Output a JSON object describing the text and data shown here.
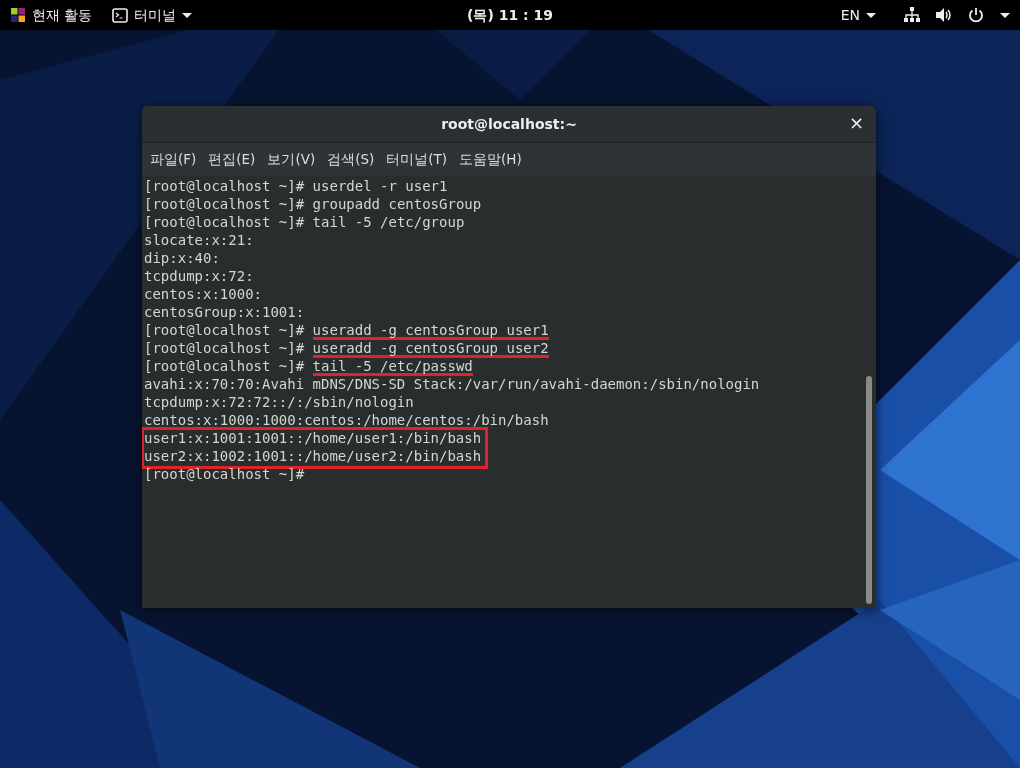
{
  "top_bar": {
    "activities": "현재 활동",
    "app_menu": "터미널",
    "clock": "(목) 11 : 19",
    "language": "EN"
  },
  "window": {
    "title": "root@localhost:~",
    "close": "×"
  },
  "menu": [
    "파일(F)",
    "편집(E)",
    "보기(V)",
    "검색(S)",
    "터미널(T)",
    "도움말(H)"
  ],
  "terminal": {
    "lines": [
      {
        "kind": "command",
        "prompt": "[root@localhost ~]#",
        "command": "userdel -r user1",
        "underlined": false,
        "boxed": false
      },
      {
        "kind": "command",
        "prompt": "[root@localhost ~]#",
        "command": "groupadd centosGroup",
        "underlined": false,
        "boxed": false
      },
      {
        "kind": "command",
        "prompt": "[root@localhost ~]#",
        "command": "tail -5 /etc/group",
        "underlined": false,
        "boxed": false
      },
      {
        "kind": "output",
        "text": "slocate:x:21:",
        "underlined": false,
        "boxed": false
      },
      {
        "kind": "output",
        "text": "dip:x:40:",
        "underlined": false,
        "boxed": false
      },
      {
        "kind": "output",
        "text": "tcpdump:x:72:",
        "underlined": false,
        "boxed": false
      },
      {
        "kind": "output",
        "text": "centos:x:1000:",
        "underlined": false,
        "boxed": false
      },
      {
        "kind": "output",
        "text": "centosGroup:x:1001:",
        "underlined": false,
        "boxed": false
      },
      {
        "kind": "command",
        "prompt": "[root@localhost ~]#",
        "command": "useradd -g centosGroup user1",
        "underlined": true,
        "boxed": false
      },
      {
        "kind": "command",
        "prompt": "[root@localhost ~]#",
        "command": "useradd -g centosGroup user2",
        "underlined": true,
        "boxed": false
      },
      {
        "kind": "command",
        "prompt": "[root@localhost ~]#",
        "command": "tail -5 /etc/passwd",
        "underlined": true,
        "boxed": false
      },
      {
        "kind": "output",
        "text": "avahi:x:70:70:Avahi mDNS/DNS-SD Stack:/var/run/avahi-daemon:/sbin/nologin",
        "underlined": false,
        "boxed": false
      },
      {
        "kind": "output",
        "text": "tcpdump:x:72:72::/:/sbin/nologin",
        "underlined": false,
        "boxed": false
      },
      {
        "kind": "output",
        "text": "centos:x:1000:1000:centos:/home/centos:/bin/bash",
        "underlined": false,
        "boxed": false
      },
      {
        "kind": "output",
        "text": "user1:x:1001:1001::/home/user1:/bin/bash",
        "underlined": false,
        "boxed": true
      },
      {
        "kind": "output",
        "text": "user2:x:1002:1001::/home/user2:/bin/bash",
        "underlined": false,
        "boxed": true
      },
      {
        "kind": "command",
        "prompt": "[root@localhost ~]#",
        "underlined": false,
        "boxed": false
      }
    ]
  }
}
